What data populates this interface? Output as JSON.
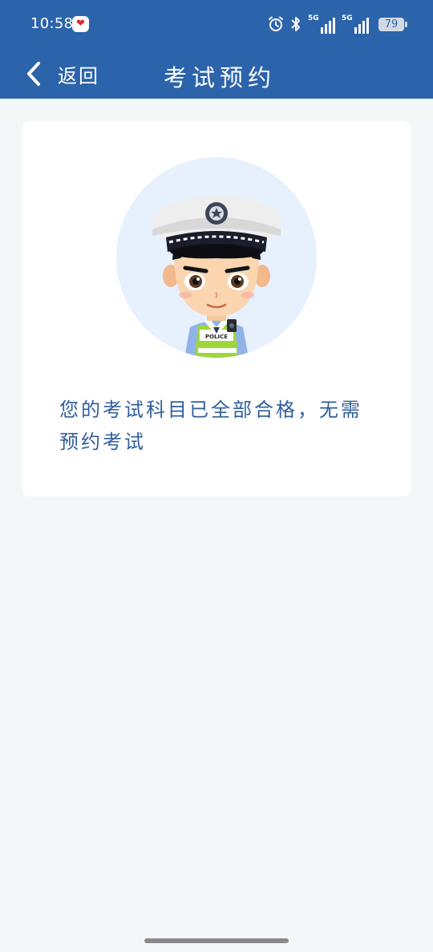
{
  "status_bar": {
    "time": "10:58",
    "app_badge_text": "❤",
    "alarm_icon": "alarm-icon",
    "bluetooth_icon": "bluetooth-icon",
    "signal1_tag": "5G",
    "signal2_tag": "5G",
    "battery": "79"
  },
  "nav": {
    "back_label": "返回",
    "title": "考试预约"
  },
  "card": {
    "message": "您的考试科目已全部合格，无需预约考试",
    "badge_text": "POLICE"
  },
  "colors": {
    "header": "#2c64ab",
    "message": "#305f9b",
    "avatar_circle": "#e7f0fd",
    "background": "#f3f7f8"
  }
}
